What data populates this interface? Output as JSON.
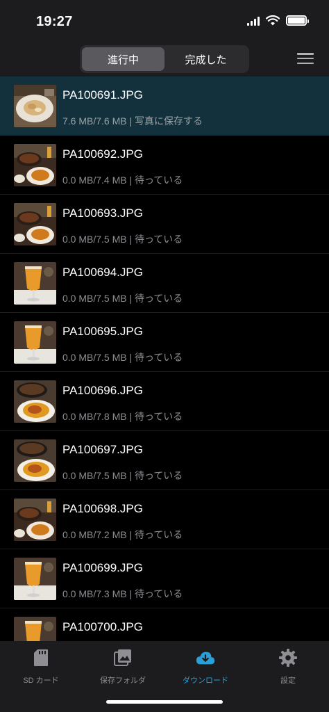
{
  "status_bar": {
    "time": "19:27"
  },
  "header": {
    "tabs": [
      {
        "label": "進行中",
        "active": true
      },
      {
        "label": "完成した",
        "active": false
      }
    ],
    "menu_icon": "hamburger-menu-icon"
  },
  "downloads": [
    {
      "name": "PA100691.JPG",
      "info": "7.6 MB/7.6 MB | 写真に保存する",
      "active": true,
      "thumb": "pasta-plate"
    },
    {
      "name": "PA100692.JPG",
      "info": "0.0 MB/7.4 MB | 待っている",
      "active": false,
      "thumb": "table-food"
    },
    {
      "name": "PA100693.JPG",
      "info": "0.0 MB/7.5 MB | 待っている",
      "active": false,
      "thumb": "table-food"
    },
    {
      "name": "PA100694.JPG",
      "info": "0.0 MB/7.5 MB | 待っている",
      "active": false,
      "thumb": "drink-glass"
    },
    {
      "name": "PA100695.JPG",
      "info": "0.0 MB/7.5 MB | 待っている",
      "active": false,
      "thumb": "drink-glass"
    },
    {
      "name": "PA100696.JPG",
      "info": "0.0 MB/7.8 MB | 待っている",
      "active": false,
      "thumb": "paella-pasta"
    },
    {
      "name": "PA100697.JPG",
      "info": "0.0 MB/7.5 MB | 待っている",
      "active": false,
      "thumb": "paella-pasta"
    },
    {
      "name": "PA100698.JPG",
      "info": "0.0 MB/7.2 MB | 待っている",
      "active": false,
      "thumb": "table-food"
    },
    {
      "name": "PA100699.JPG",
      "info": "0.0 MB/7.3 MB | 待っている",
      "active": false,
      "thumb": "drink-glass"
    },
    {
      "name": "PA100700.JPG",
      "info": "",
      "active": false,
      "thumb": "drink-glass"
    }
  ],
  "tabbar": [
    {
      "label": "SD カード",
      "icon": "sd-card-icon",
      "active": false
    },
    {
      "label": "保存フォルダ",
      "icon": "photo-library-icon",
      "active": false
    },
    {
      "label": "ダウンロード",
      "icon": "cloud-download-icon",
      "active": true
    },
    {
      "label": "設定",
      "icon": "gear-icon",
      "active": false
    }
  ],
  "colors": {
    "accent": "#2a9fd8",
    "active_row": "#13313c",
    "bar_bg": "#1c1c1e"
  }
}
